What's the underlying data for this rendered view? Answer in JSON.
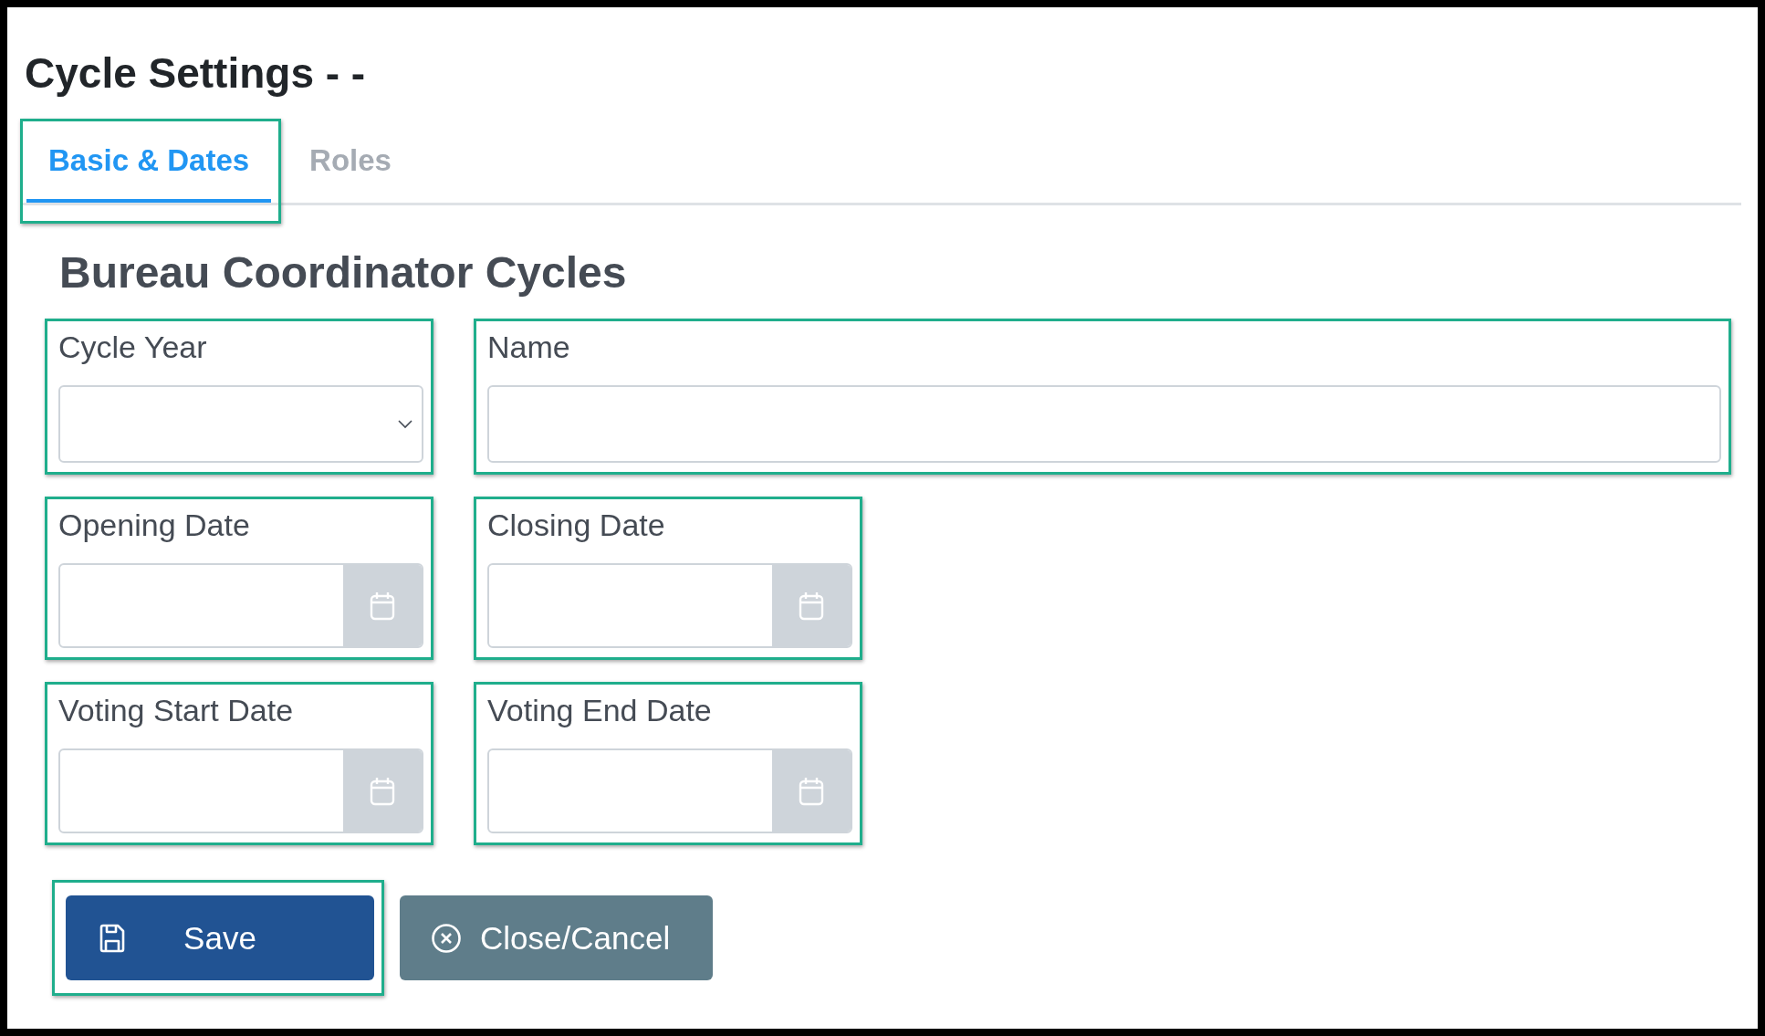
{
  "title": "Cycle Settings - -",
  "tabs": [
    {
      "label": "Basic & Dates",
      "selected": true,
      "highlighted": true
    },
    {
      "label": "Roles",
      "selected": false,
      "highlighted": false
    }
  ],
  "section_title": "Bureau Coordinator Cycles",
  "fields": [
    {
      "label": "Cycle Year",
      "kind": "select",
      "highlighted": true
    },
    {
      "label": "Name",
      "kind": "text",
      "highlighted": true
    },
    {
      "label": "Opening Date",
      "kind": "date",
      "highlighted": true
    },
    {
      "label": "Closing Date",
      "kind": "date",
      "highlighted": true
    },
    {
      "label": "Voting Start Date",
      "kind": "date",
      "highlighted": true
    },
    {
      "label": "Voting End Date",
      "kind": "date",
      "highlighted": true
    }
  ],
  "buttons": [
    {
      "label": "Save",
      "kind": "save",
      "highlighted": true
    },
    {
      "label": "Close/Cancel",
      "kind": "cancel",
      "highlighted": false
    }
  ]
}
